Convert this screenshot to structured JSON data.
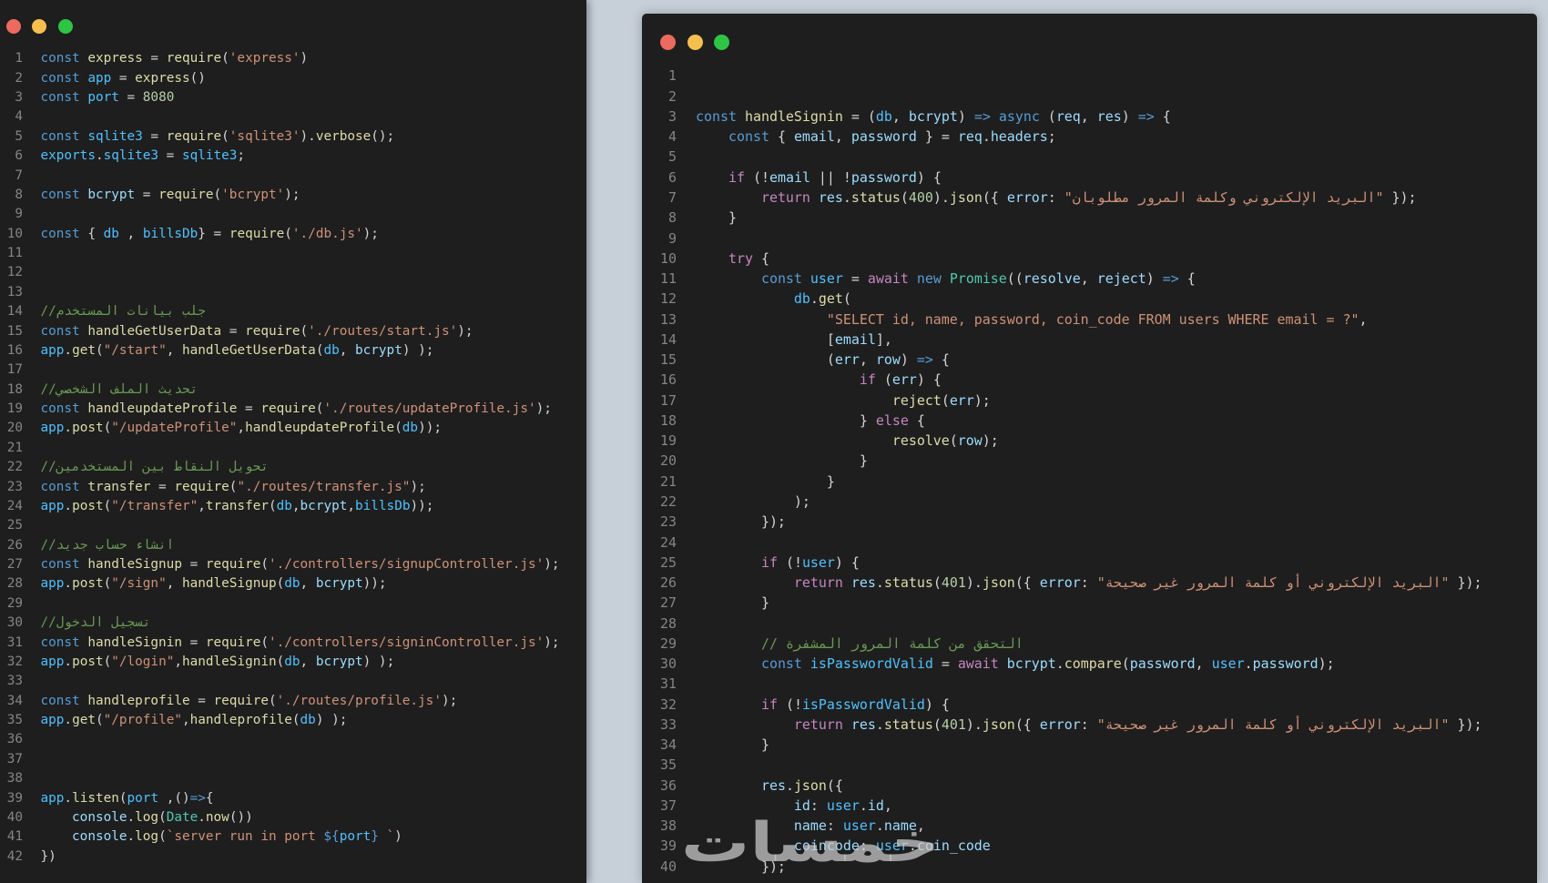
{
  "colors": {
    "page_background": "#c7cfd9",
    "editor_background": "#1e1e1e",
    "line_number": "#858585",
    "plain": "#d4d4d4",
    "keyword": "#569cd6",
    "control": "#c586c0",
    "function": "#dcdcaa",
    "constant": "#4fc1ff",
    "variable": "#9cdcfe",
    "class": "#4ec9b0",
    "string": "#ce9178",
    "number": "#b5cea8",
    "comment": "#6a9955",
    "close_dot": "#ed6a5e",
    "minimize_dot": "#f4bf4f",
    "zoom_dot": "#2ec445"
  },
  "window_controls": {
    "close": "close-dot-icon",
    "minimize": "minimize-dot-icon",
    "zoom": "zoom-dot-icon"
  },
  "left_editor": {
    "lines": [
      {
        "n": 1,
        "code": "const express = require('express')"
      },
      {
        "n": 2,
        "code": "const app = express()"
      },
      {
        "n": 3,
        "code": "const port = 8080"
      },
      {
        "n": 4,
        "code": ""
      },
      {
        "n": 5,
        "code": "const sqlite3 = require('sqlite3').verbose();"
      },
      {
        "n": 6,
        "code": "exports.sqlite3 = sqlite3;"
      },
      {
        "n": 7,
        "code": ""
      },
      {
        "n": 8,
        "code": "const bcrypt = require('bcrypt');"
      },
      {
        "n": 9,
        "code": ""
      },
      {
        "n": 10,
        "code": "const { db , billsDb} = require('./db.js');"
      },
      {
        "n": 11,
        "code": ""
      },
      {
        "n": 12,
        "code": ""
      },
      {
        "n": 13,
        "code": ""
      },
      {
        "n": 14,
        "code": "//جلب بيانات المستخدم"
      },
      {
        "n": 15,
        "code": "const handleGetUserData = require('./routes/start.js');"
      },
      {
        "n": 16,
        "code": "app.get(\"/start\", handleGetUserData(db, bcrypt) );"
      },
      {
        "n": 17,
        "code": ""
      },
      {
        "n": 18,
        "code": "//تحديث الملف الشخصي"
      },
      {
        "n": 19,
        "code": "const handleupdateProfile = require('./routes/updateProfile.js');"
      },
      {
        "n": 20,
        "code": "app.post(\"/updateProfile\",handleupdateProfile(db));"
      },
      {
        "n": 21,
        "code": ""
      },
      {
        "n": 22,
        "code": "//تحويل النقاط بين المستخدمين"
      },
      {
        "n": 23,
        "code": "const transfer = require(\"./routes/transfer.js\");"
      },
      {
        "n": 24,
        "code": "app.post(\"/transfer\",transfer(db,bcrypt,billsDb));"
      },
      {
        "n": 25,
        "code": ""
      },
      {
        "n": 26,
        "code": "//انشاء حساب جديد"
      },
      {
        "n": 27,
        "code": "const handleSignup = require('./controllers/signupController.js');"
      },
      {
        "n": 28,
        "code": "app.post(\"/sign\", handleSignup(db, bcrypt));"
      },
      {
        "n": 29,
        "code": ""
      },
      {
        "n": 30,
        "code": "//تسجيل الدخول"
      },
      {
        "n": 31,
        "code": "const handleSignin = require('./controllers/signinController.js');"
      },
      {
        "n": 32,
        "code": "app.post(\"/login\",handleSignin(db, bcrypt) );"
      },
      {
        "n": 33,
        "code": ""
      },
      {
        "n": 34,
        "code": "const handleprofile = require('./routes/profile.js');"
      },
      {
        "n": 35,
        "code": "app.get(\"/profile\",handleprofile(db) );"
      },
      {
        "n": 36,
        "code": ""
      },
      {
        "n": 37,
        "code": ""
      },
      {
        "n": 38,
        "code": ""
      },
      {
        "n": 39,
        "code": "app.listen(port ,()=>{"
      },
      {
        "n": 40,
        "code": "    console.log(Date.now())"
      },
      {
        "n": 41,
        "code": "    console.log(`server run in port ${port} `)"
      },
      {
        "n": 42,
        "code": "})"
      }
    ]
  },
  "right_editor": {
    "lines": [
      {
        "n": 1,
        "code": ""
      },
      {
        "n": 2,
        "code": ""
      },
      {
        "n": 3,
        "code": "const handleSignin = (db, bcrypt) => async (req, res) => {"
      },
      {
        "n": 4,
        "code": "    const { email, password } = req.headers;"
      },
      {
        "n": 5,
        "code": ""
      },
      {
        "n": 6,
        "code": "    if (!email || !password) {"
      },
      {
        "n": 7,
        "code": "        return res.status(400).json({ error: \"البريد الإلكتروني وكلمة المرور مطلوبان\" });"
      },
      {
        "n": 8,
        "code": "    }"
      },
      {
        "n": 9,
        "code": ""
      },
      {
        "n": 10,
        "code": "    try {"
      },
      {
        "n": 11,
        "code": "        const user = await new Promise((resolve, reject) => {"
      },
      {
        "n": 12,
        "code": "            db.get("
      },
      {
        "n": 13,
        "code": "                \"SELECT id, name, password, coin_code FROM users WHERE email = ?\","
      },
      {
        "n": 14,
        "code": "                [email],"
      },
      {
        "n": 15,
        "code": "                (err, row) => {"
      },
      {
        "n": 16,
        "code": "                    if (err) {"
      },
      {
        "n": 17,
        "code": "                        reject(err);"
      },
      {
        "n": 18,
        "code": "                    } else {"
      },
      {
        "n": 19,
        "code": "                        resolve(row);"
      },
      {
        "n": 20,
        "code": "                    }"
      },
      {
        "n": 21,
        "code": "                }"
      },
      {
        "n": 22,
        "code": "            );"
      },
      {
        "n": 23,
        "code": "        });"
      },
      {
        "n": 24,
        "code": ""
      },
      {
        "n": 25,
        "code": "        if (!user) {"
      },
      {
        "n": 26,
        "code": "            return res.status(401).json({ error: \"البريد الإلكتروني أو كلمة المرور غير صحيحة\" });"
      },
      {
        "n": 27,
        "code": "        }"
      },
      {
        "n": 28,
        "code": ""
      },
      {
        "n": 29,
        "code": "        // التحقق من كلمة المرور المشفرة"
      },
      {
        "n": 30,
        "code": "        const isPasswordValid = await bcrypt.compare(password, user.password);"
      },
      {
        "n": 31,
        "code": ""
      },
      {
        "n": 32,
        "code": "        if (!isPasswordValid) {"
      },
      {
        "n": 33,
        "code": "            return res.status(401).json({ error: \"البريد الإلكتروني أو كلمة المرور غير صحيحة\" });"
      },
      {
        "n": 34,
        "code": "        }"
      },
      {
        "n": 35,
        "code": ""
      },
      {
        "n": 36,
        "code": "        res.json({"
      },
      {
        "n": 37,
        "code": "            id: user.id,"
      },
      {
        "n": 38,
        "code": "            name: user.name,"
      },
      {
        "n": 39,
        "code": "            coincode: user.coin_code"
      },
      {
        "n": 40,
        "code": "        });"
      }
    ]
  },
  "watermark": "خمسات"
}
